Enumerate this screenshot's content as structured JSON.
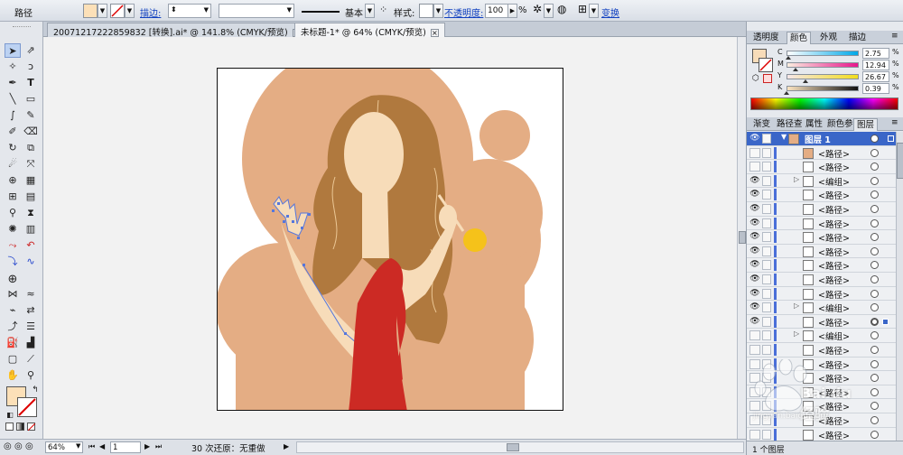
{
  "control_bar": {
    "object_type": "路径",
    "stroke_label": "描边:",
    "stroke_profile": "基本",
    "style_label": "样式:",
    "opacity_label": "不透明度:",
    "opacity_value": "100",
    "opacity_unit": "%",
    "transform_label": "变换",
    "fill_color": "#fce0b8"
  },
  "tabs": [
    {
      "label": "20071217222859832 [转换].ai* @ 141.8% (CMYK/预览)",
      "close": "×"
    },
    {
      "label": "未标题-1* @ 64% (CMYK/预览)",
      "close": "×"
    }
  ],
  "color_panel": {
    "tabs": [
      "透明度",
      "颜色",
      "外观",
      "描边"
    ],
    "active_tab": "颜色",
    "channels": [
      {
        "label": "C",
        "value": "2.75",
        "unit": "%",
        "fraction": 0.0275
      },
      {
        "label": "M",
        "value": "12.94",
        "unit": "%",
        "fraction": 0.1294
      },
      {
        "label": "Y",
        "value": "26.67",
        "unit": "%",
        "fraction": 0.2667
      },
      {
        "label": "K",
        "value": "0.39",
        "unit": "%",
        "fraction": 0.0039
      }
    ],
    "fill_color": "#f7dcb9"
  },
  "layers_panel": {
    "tabs": [
      "渐变",
      "路径查",
      "属性",
      "颜色参",
      "图层"
    ],
    "active_tab": "图层",
    "top_layer": "图层 1",
    "rows": [
      {
        "name": "<路径>",
        "eye": false,
        "expand": false
      },
      {
        "name": "<路径>",
        "eye": false,
        "expand": false
      },
      {
        "name": "<编组>",
        "eye": true,
        "expand": true
      },
      {
        "name": "<路径>",
        "eye": true,
        "expand": false
      },
      {
        "name": "<路径>",
        "eye": true,
        "expand": false
      },
      {
        "name": "<路径>",
        "eye": true,
        "expand": false
      },
      {
        "name": "<路径>",
        "eye": true,
        "expand": false
      },
      {
        "name": "<路径>",
        "eye": true,
        "expand": false
      },
      {
        "name": "<路径>",
        "eye": true,
        "expand": false
      },
      {
        "name": "<路径>",
        "eye": true,
        "expand": false
      },
      {
        "name": "<路径>",
        "eye": true,
        "expand": false
      },
      {
        "name": "<编组>",
        "eye": true,
        "expand": true
      },
      {
        "name": "<路径>",
        "eye": true,
        "expand": false,
        "selected": true
      },
      {
        "name": "<编组>",
        "eye": false,
        "expand": true
      },
      {
        "name": "<路径>",
        "eye": false,
        "expand": false
      },
      {
        "name": "<路径>",
        "eye": false,
        "expand": false
      },
      {
        "name": "<路径>",
        "eye": false,
        "expand": false
      },
      {
        "name": "<路径>",
        "eye": false,
        "expand": false
      },
      {
        "name": "<路径>",
        "eye": false,
        "expand": false
      },
      {
        "name": "<路径>",
        "eye": false,
        "expand": false
      },
      {
        "name": "<路径>",
        "eye": false,
        "expand": false
      }
    ],
    "footer": "1 个图层"
  },
  "status_bar": {
    "zoom": "64%",
    "artboard": "1",
    "undo_info": "30 次还原：无重做"
  },
  "toolbox": {
    "fill_color": "#fce0b8"
  },
  "artwork": {
    "bg_blob": "#e4ad84",
    "dot": "#e4ad84",
    "hair": "#b0793e",
    "skin": "#f7dcb9",
    "dress": "#cc2a24",
    "lemon": "#f5c21a"
  },
  "watermark": {
    "text": "Bai du 经验",
    "sub": "jingyan.baidu.com"
  }
}
